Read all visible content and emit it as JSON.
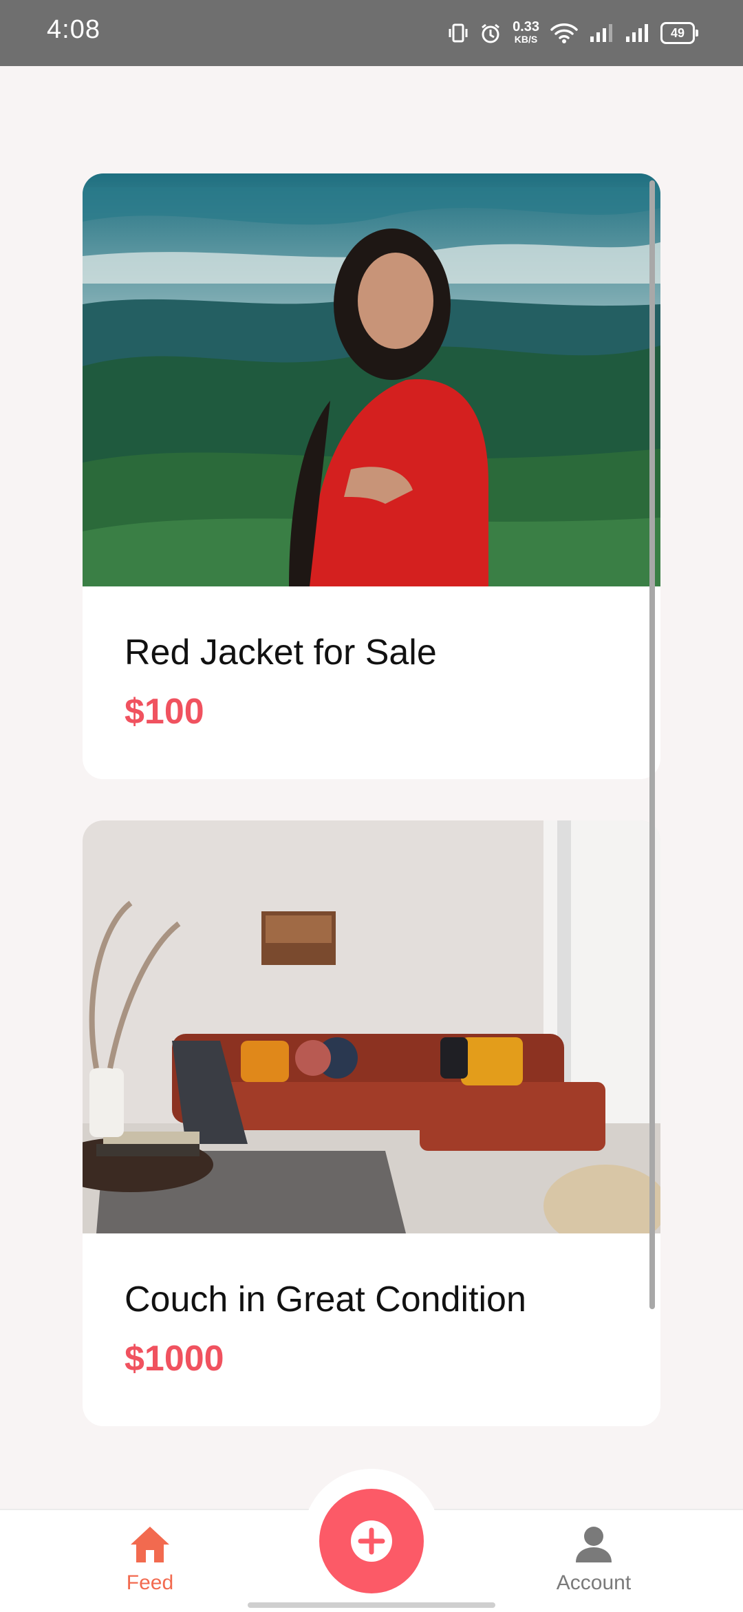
{
  "status_bar": {
    "time": "4:08",
    "net_speed_value": "0.33",
    "net_speed_unit": "KB/S",
    "battery": "49"
  },
  "listings": [
    {
      "title": "Red Jacket for Sale",
      "price": "$100"
    },
    {
      "title": "Couch in Great Condition",
      "price": "$1000"
    }
  ],
  "bottom_nav": {
    "feed_label": "Feed",
    "account_label": "Account"
  },
  "colors": {
    "accent": "#fc5a67",
    "price": "#f0525f",
    "nav_active": "#f26a4f",
    "background": "#f8f4f4"
  }
}
